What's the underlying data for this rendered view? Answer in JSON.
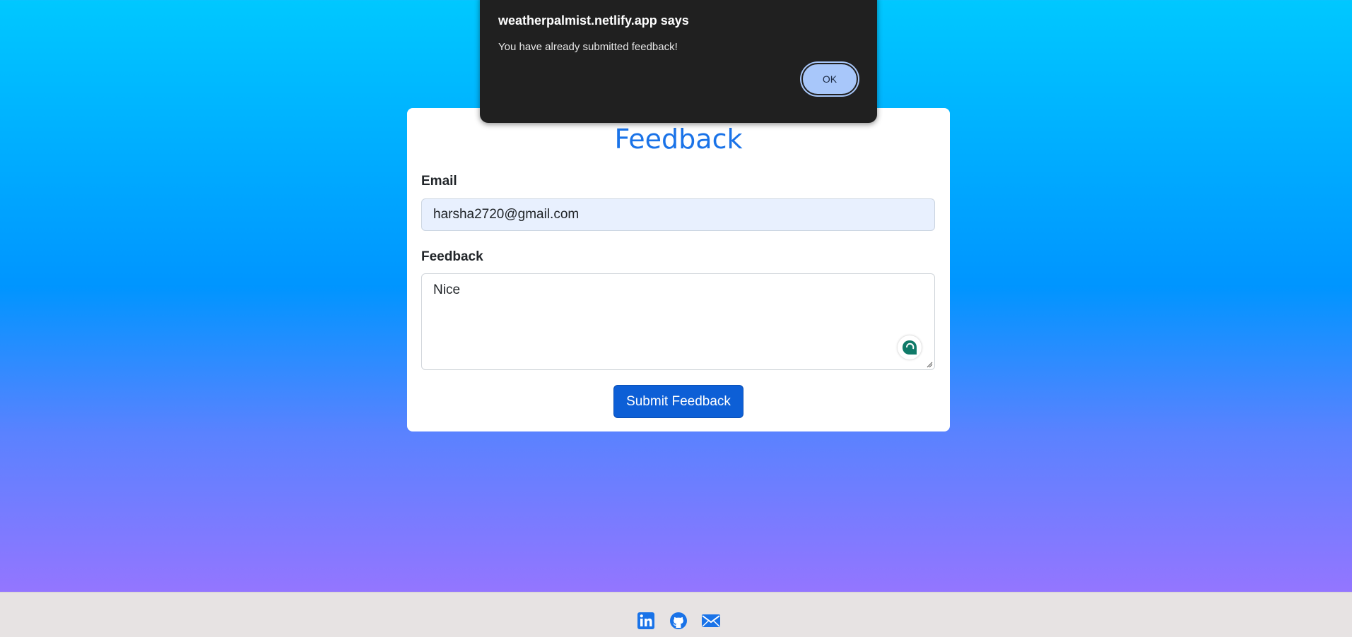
{
  "feedback_form": {
    "title": "Feedback",
    "email_label": "Email",
    "email_value": "harsha2720@gmail.com",
    "feedback_label": "Feedback",
    "feedback_value": "Nice",
    "submit_label": "Submit Feedback"
  },
  "alert": {
    "title": "weatherpalmist.netlify.app says",
    "message": "You have already submitted feedback!",
    "ok_label": "OK"
  },
  "footer": {
    "icons": [
      "linkedin-icon",
      "github-icon",
      "mail-icon"
    ]
  },
  "colors": {
    "accent": "#1a73e8",
    "button": "#0d5fd6",
    "footer_background": "#e7e3e3",
    "dialog_background": "#202020"
  }
}
